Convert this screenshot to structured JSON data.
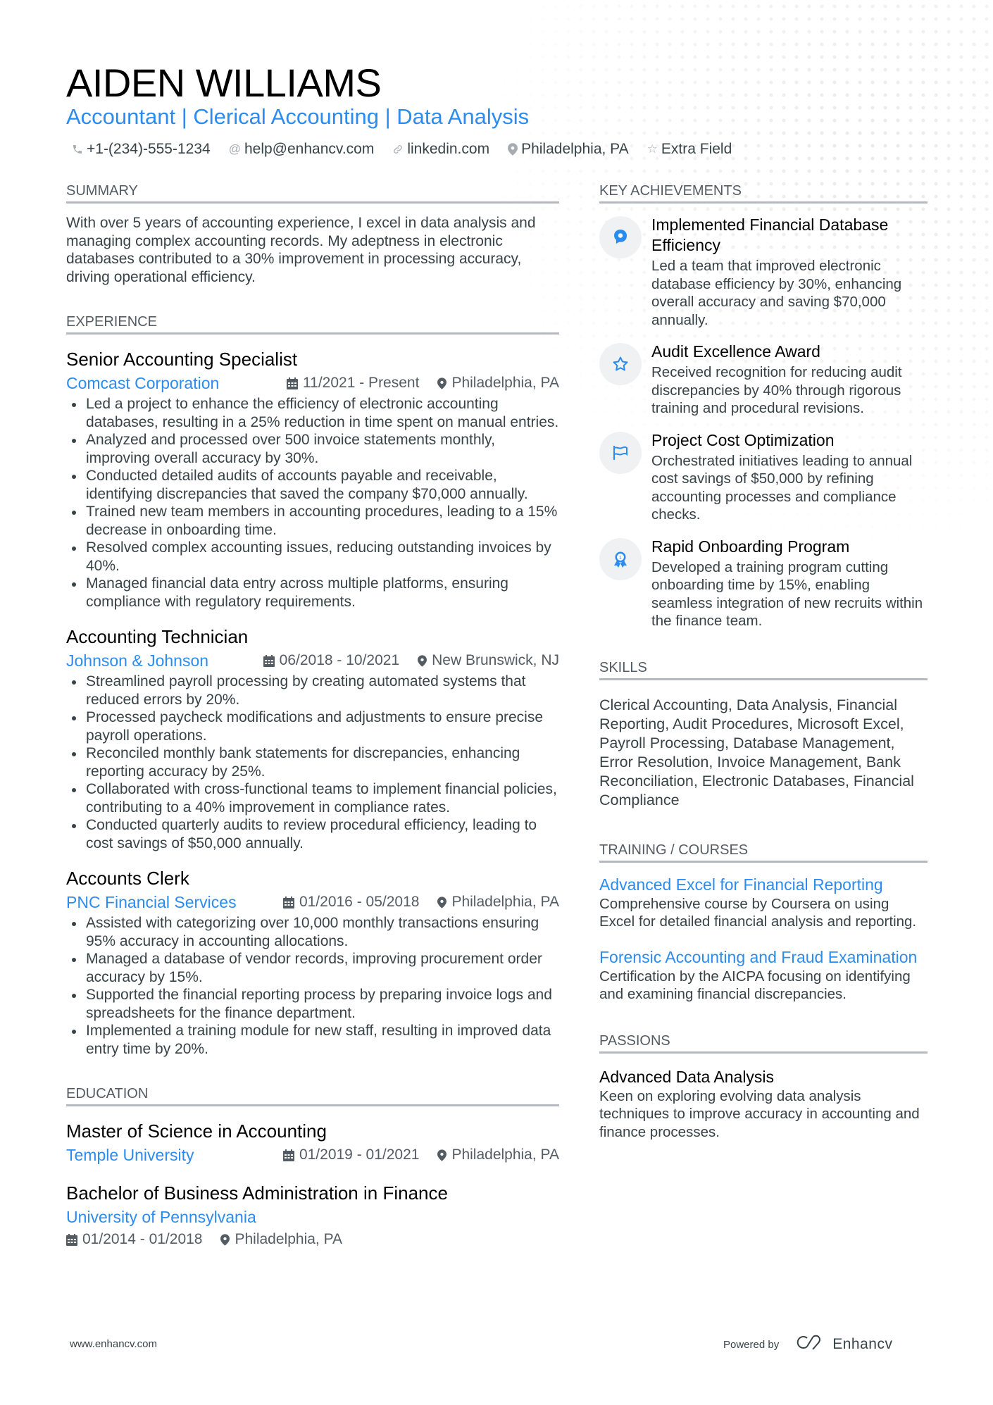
{
  "header": {
    "name": "AIDEN WILLIAMS",
    "title": "Accountant | Clerical Accounting | Data Analysis",
    "contacts": [
      {
        "icon": "phone-icon",
        "text": "+1-(234)-555-1234"
      },
      {
        "icon": "at-icon",
        "text": "help@enhancv.com"
      },
      {
        "icon": "link-icon",
        "text": "linkedin.com"
      },
      {
        "icon": "location-icon",
        "text": "Philadelphia, PA"
      },
      {
        "icon": "star-icon",
        "text": "Extra Field"
      }
    ]
  },
  "summary": {
    "heading": "SUMMARY",
    "text": "With over 5 years of accounting experience, I excel in data analysis and managing complex accounting records. My adeptness in electronic databases contributed to a 30% improvement in processing accuracy, driving operational efficiency."
  },
  "experience": {
    "heading": "EXPERIENCE",
    "roles": [
      {
        "title": "Senior Accounting Specialist",
        "company": "Comcast Corporation",
        "dates": "11/2021 - Present",
        "location": "Philadelphia, PA",
        "bullets": [
          "Led a project to enhance the efficiency of electronic accounting databases, resulting in a 25% reduction in time spent on manual entries.",
          "Analyzed and processed over 500 invoice statements monthly, improving overall accuracy by 30%.",
          "Conducted detailed audits of accounts payable and receivable, identifying discrepancies that saved the company $70,000 annually.",
          "Trained new team members in accounting procedures, leading to a 15% decrease in onboarding time.",
          "Resolved complex accounting issues, reducing outstanding invoices by 40%.",
          "Managed financial data entry across multiple platforms, ensuring compliance with regulatory requirements."
        ]
      },
      {
        "title": "Accounting Technician",
        "company": "Johnson & Johnson",
        "dates": "06/2018 - 10/2021",
        "location": "New Brunswick, NJ",
        "bullets": [
          "Streamlined payroll processing by creating automated systems that reduced errors by 20%.",
          "Processed paycheck modifications and adjustments to ensure precise payroll operations.",
          "Reconciled monthly bank statements for discrepancies, enhancing reporting accuracy by 25%.",
          "Collaborated with cross-functional teams to implement financial policies, contributing to a 40% improvement in compliance rates.",
          "Conducted quarterly audits to review procedural efficiency, leading to cost savings of $50,000 annually."
        ]
      },
      {
        "title": "Accounts Clerk",
        "company": "PNC Financial Services",
        "dates": "01/2016 - 05/2018",
        "location": "Philadelphia, PA",
        "bullets": [
          "Assisted with categorizing over 10,000 monthly transactions ensuring 95% accuracy in accounting allocations.",
          "Managed a database of vendor records, improving procurement order accuracy by 15%.",
          "Supported the financial reporting process by preparing invoice logs and spreadsheets for the finance department.",
          "Implemented a training module for new staff, resulting in improved data entry time by 20%."
        ]
      }
    ]
  },
  "education": {
    "heading": "EDUCATION",
    "items": [
      {
        "degree": "Master of Science in Accounting",
        "school": "Temple University",
        "dates": "01/2019 - 01/2021",
        "location": "Philadelphia, PA"
      },
      {
        "degree": "Bachelor of Business Administration in Finance",
        "school": "University of Pennsylvania",
        "dates": "01/2014 - 01/2018",
        "location": "Philadelphia, PA"
      }
    ]
  },
  "achievements": {
    "heading": "KEY ACHIEVEMENTS",
    "items": [
      {
        "icon": "brain-icon",
        "title": "Implemented Financial Database Efficiency",
        "desc": "Led a team that improved electronic database efficiency by 30%, enhancing overall accuracy and saving $70,000 annually."
      },
      {
        "icon": "star-icon",
        "title": "Audit Excellence Award",
        "desc": "Received recognition for reducing audit discrepancies by 40% through rigorous training and procedural revisions."
      },
      {
        "icon": "flag-icon",
        "title": "Project Cost Optimization",
        "desc": "Orchestrated initiatives leading to annual cost savings of $50,000 by refining accounting processes and compliance checks."
      },
      {
        "icon": "medal-icon",
        "title": "Rapid Onboarding Program",
        "desc": "Developed a training program cutting onboarding time by 15%, enabling seamless integration of new recruits within the finance team."
      }
    ]
  },
  "skills": {
    "heading": "SKILLS",
    "text": "Clerical Accounting, Data Analysis, Financial Reporting, Audit Procedures, Microsoft Excel, Payroll Processing, Database Management, Error Resolution, Invoice Management, Bank Reconciliation, Electronic Databases, Financial Compliance"
  },
  "training": {
    "heading": "TRAINING / COURSES",
    "items": [
      {
        "title": "Advanced Excel for Financial Reporting",
        "desc": "Comprehensive course by Coursera on using Excel for detailed financial analysis and reporting."
      },
      {
        "title": "Forensic Accounting and Fraud Examination",
        "desc": "Certification by the AICPA focusing on identifying and examining financial discrepancies."
      }
    ]
  },
  "passions": {
    "heading": "PASSIONS",
    "items": [
      {
        "title": "Advanced Data Analysis",
        "desc": "Keen on exploring evolving data analysis techniques to improve accuracy in accounting and finance processes."
      }
    ]
  },
  "footer": {
    "website": "www.enhancv.com",
    "powered_by": "Powered by",
    "brand": "Enhancv"
  },
  "colors": {
    "accent": "#2b8cf0",
    "text": "#384347",
    "heading_rule": "#b4b9bf"
  }
}
